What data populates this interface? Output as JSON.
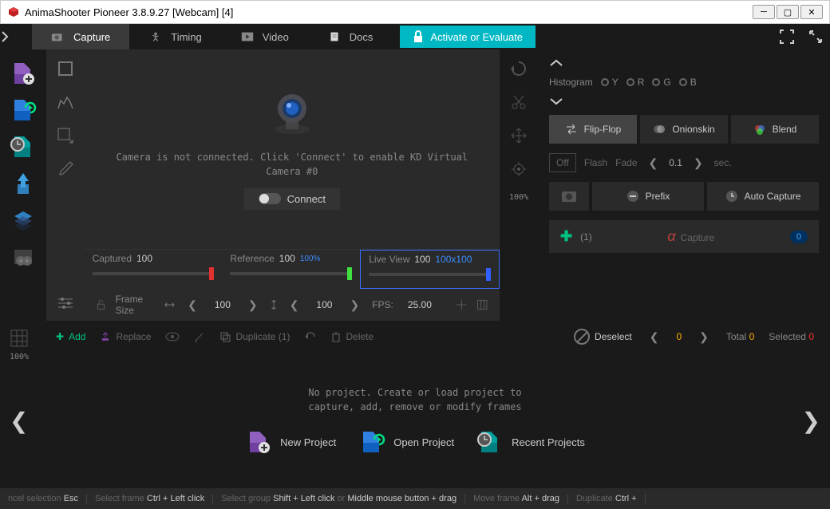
{
  "titlebar": {
    "text": "AnimaShooter Pioneer 3.8.9.27 [Webcam]  [4]"
  },
  "tabs": {
    "capture": "Capture",
    "timing": "Timing",
    "video": "Video",
    "docs": "Docs"
  },
  "activate": "Activate or Evaluate",
  "camera": {
    "message": "Camera is not connected. Click 'Connect' to enable KD Virtual Camera #0",
    "connect": "Connect"
  },
  "sliders": {
    "captured": {
      "label": "Captured",
      "value": "100"
    },
    "reference": {
      "label": "Reference",
      "value": "100",
      "pct": "100%"
    },
    "liveview": {
      "label": "Live View",
      "value": "100",
      "dim": "100x100"
    }
  },
  "frame": {
    "label": "Frame Size",
    "w": "100",
    "h": "100",
    "fps_label": "FPS:",
    "fps": "25.00"
  },
  "side": {
    "pct": "100%"
  },
  "right": {
    "histogram": "Histogram",
    "channels": [
      "Y",
      "R",
      "G",
      "B"
    ],
    "modes": {
      "flipflop": "Flip-Flop",
      "onionskin": "Onionskin",
      "blend": "Blend"
    },
    "flash": {
      "off": "Off",
      "flash": "Flash",
      "fade": "Fade",
      "value": "0.1",
      "unit": "sec."
    },
    "prefix": "Prefix",
    "autocapture": "Auto Capture",
    "capture": {
      "count": "(1)",
      "label": "Capture",
      "badge": "0"
    }
  },
  "actions": {
    "add": "Add",
    "replace": "Replace",
    "duplicate": "Duplicate (1)",
    "delete": "Delete",
    "deselect": "Deselect",
    "current": "0",
    "total_label": "Total",
    "total": "0",
    "selected_label": "Selected",
    "selected": "0"
  },
  "timeline": {
    "msg": "No project. Create or load project to\ncapture, add, remove or modify frames",
    "new": "New Project",
    "open": "Open Project",
    "recent": "Recent Projects"
  },
  "zoom": "100%",
  "statusbar": {
    "s1a": "ncel selection",
    "s1b": "Esc",
    "s2a": "Select frame",
    "s2b": "Ctrl + Left click",
    "s3a": "Select group",
    "s3b": "Shift + Left click",
    "s3c": "or",
    "s3d": "Middle mouse button + drag",
    "s4a": "Move frame",
    "s4b": "Alt + drag",
    "s5a": "Duplicate",
    "s5b": "Ctrl +"
  }
}
